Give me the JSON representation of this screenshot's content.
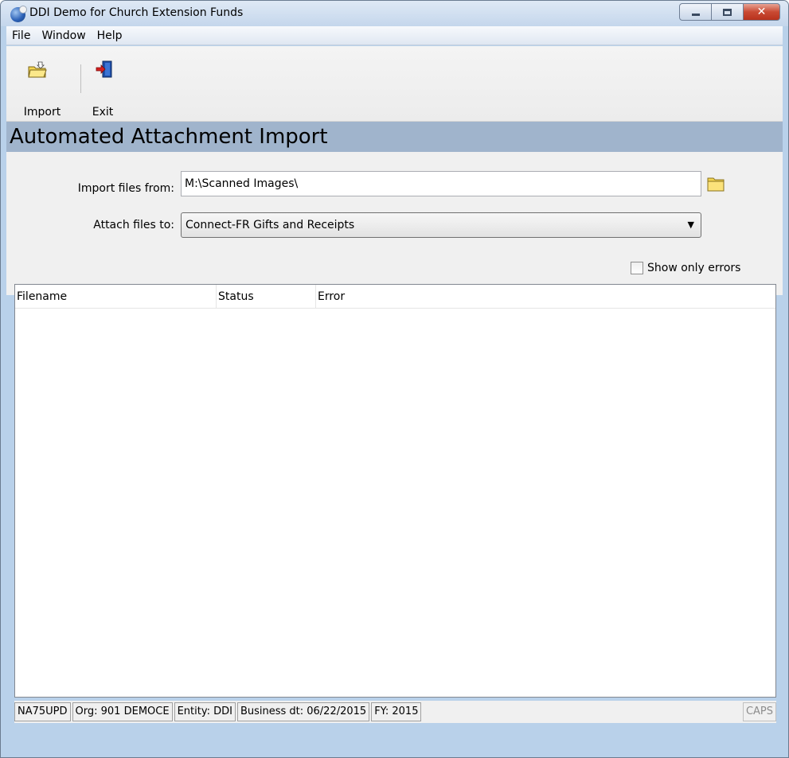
{
  "window": {
    "title": "DDI Demo for Church Extension Funds",
    "icon": "app-globe-icon",
    "controls": {
      "minimize": "minimize-icon",
      "maximize": "maximize-icon",
      "close": "✕"
    }
  },
  "menu": {
    "file": "File",
    "window": "Window",
    "help": "Help"
  },
  "toolbar": {
    "import_label": "Import",
    "import_icon": "open-folder-icon",
    "exit_label": "Exit",
    "exit_icon": "exit-door-icon"
  },
  "section": {
    "title": "Automated Attachment Import"
  },
  "form": {
    "import_from_label": "Import files from:",
    "import_from_value": "M:\\Scanned Images\\",
    "browse_icon": "folder-icon",
    "attach_to_label": "Attach files to:",
    "attach_to_value": "Connect-FR Gifts and Receipts",
    "show_only_errors_label": "Show only errors",
    "show_only_errors_checked": false
  },
  "list": {
    "columns": [
      "Filename",
      "Status",
      "Error"
    ],
    "rows": []
  },
  "status_bar": {
    "user": "NA75UPD",
    "org": "Org: 901 DEMOCE",
    "entity": "Entity: DDI",
    "business_date": "Business dt: 06/22/2015",
    "fiscal_year": "FY: 2015",
    "caps": "CAPS"
  },
  "colors": {
    "window_frame": "#b9d1ea",
    "section_header": "#a0b4cc",
    "panel_bg": "#f0f0f0",
    "close_button": "#c94a33"
  }
}
